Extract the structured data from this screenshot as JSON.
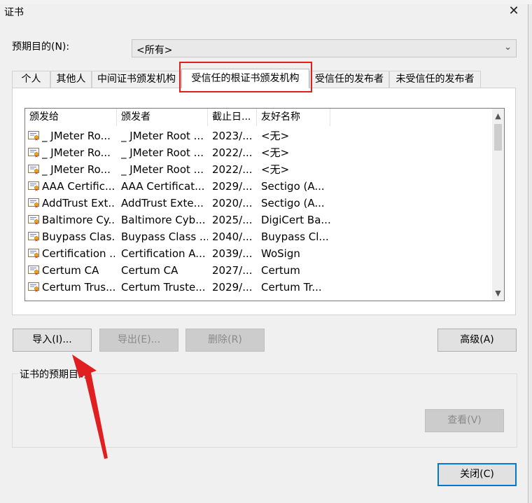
{
  "window": {
    "title": "证书"
  },
  "purpose": {
    "label": "预期目的(N):",
    "value": "<所有>"
  },
  "tabs": [
    "个人",
    "其他人",
    "中间证书颁发机构",
    "受信任的根证书颁发机构",
    "受信任的发布者",
    "未受信任的发布者"
  ],
  "active_tab": "受信任的根证书颁发机构",
  "columns": {
    "issued_to": "颁发给",
    "issued_by": "颁发者",
    "expiration": "截止日...",
    "friendly_name": "友好名称"
  },
  "rows": [
    {
      "issued_to": "_ JMeter Ro...",
      "issued_by": "_ JMeter Root ...",
      "expiration": "2023/...",
      "friendly_name": "<无>"
    },
    {
      "issued_to": "_ JMeter Ro...",
      "issued_by": "_ JMeter Root ...",
      "expiration": "2022/...",
      "friendly_name": "<无>"
    },
    {
      "issued_to": "_ JMeter Ro...",
      "issued_by": "_ JMeter Root ...",
      "expiration": "2022/...",
      "friendly_name": "<无>"
    },
    {
      "issued_to": "AAA Certific...",
      "issued_by": "AAA Certificat...",
      "expiration": "2029/...",
      "friendly_name": "Sectigo (A..."
    },
    {
      "issued_to": "AddTrust Ext...",
      "issued_by": "AddTrust Exte...",
      "expiration": "2020/...",
      "friendly_name": "Sectigo (A..."
    },
    {
      "issued_to": "Baltimore Cy...",
      "issued_by": "Baltimore Cyb...",
      "expiration": "2025/...",
      "friendly_name": "DigiCert Ba..."
    },
    {
      "issued_to": "Buypass Clas...",
      "issued_by": "Buypass Class ...",
      "expiration": "2040/...",
      "friendly_name": "Buypass Cl..."
    },
    {
      "issued_to": "Certification ...",
      "issued_by": "Certification A...",
      "expiration": "2039/...",
      "friendly_name": "WoSign"
    },
    {
      "issued_to": "Certum CA",
      "issued_by": "Certum CA",
      "expiration": "2027/...",
      "friendly_name": "Certum"
    },
    {
      "issued_to": "Certum Trus...",
      "issued_by": "Certum Truste...",
      "expiration": "2029/...",
      "friendly_name": "Certum Tr..."
    }
  ],
  "buttons": {
    "import": "导入(I)...",
    "export": "导出(E)...",
    "remove": "删除(R)",
    "advanced": "高级(A)",
    "view": "查看(V)",
    "close": "关闭(C)"
  },
  "purposes_group": {
    "label": "证书的预期目的"
  },
  "icons": {
    "close": "close-icon",
    "dropdown": "chevron-down-icon",
    "certificate": "certificate-icon"
  },
  "colors": {
    "highlight": "#e02020",
    "default_button_border": "#0078d7"
  }
}
